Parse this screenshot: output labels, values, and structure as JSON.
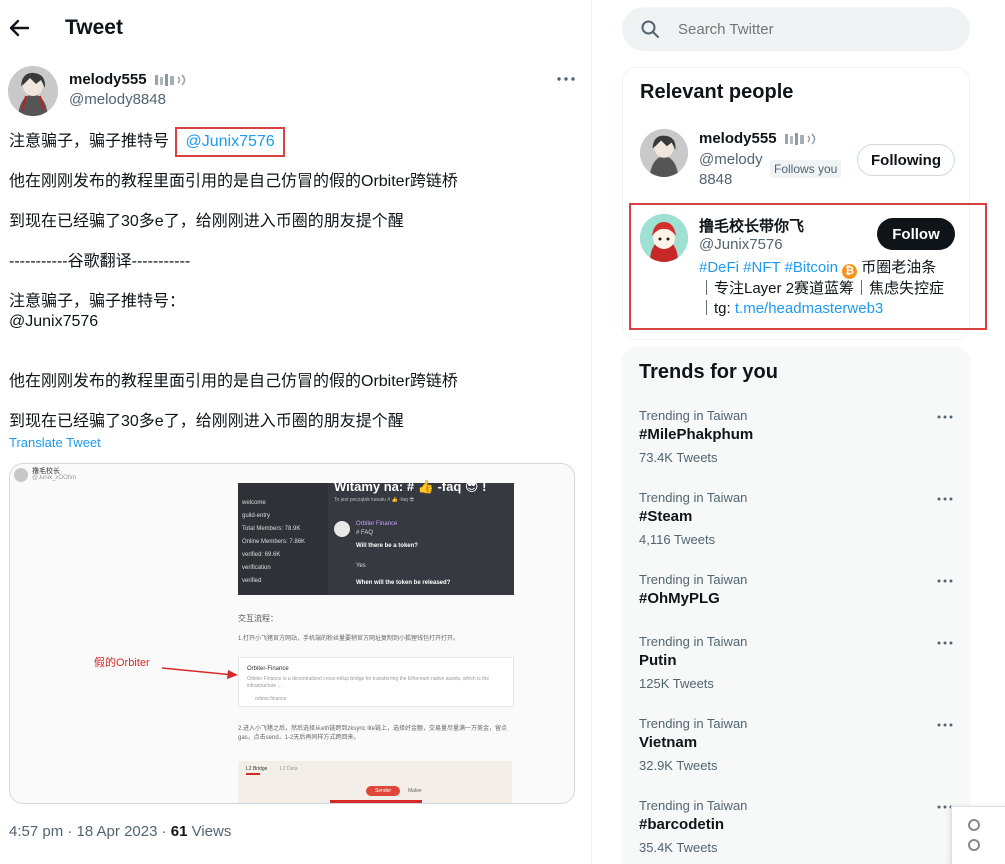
{
  "header": {
    "title": "Tweet",
    "back_icon": "arrow-left-icon"
  },
  "tweet": {
    "author_name": "melody555",
    "author_badge_icon": "fan-emoji-icon",
    "author_handle": "@melody8848",
    "lines": [
      "注意骗子，骗子推特号",
      "他在刚刚发布的教程里面引用的是自己仿冒的假的Orbiter跨链桥",
      "到现在已经骗了30多e了，给刚刚进入币圈的朋友提个醒",
      "-----------谷歌翻译-----------",
      "注意骗子，骗子推特号：",
      "@Junix7576",
      "他在刚刚发布的教程里面引用的是自己仿冒的假的Orbiter跨链桥",
      "到现在已经骗了30多e了，给刚刚进入币圈的朋友提个醒"
    ],
    "mention": "@Junix7576",
    "translate_label": "Translate Tweet",
    "time": "4:57 pm · 18 Apr 2023 · ",
    "views_count": "61",
    "views_label": " Views",
    "media": {
      "embedded_username": "撸毛校长",
      "embedded_handle": "@Junix_xOOhm",
      "discord_heading": "Witamy na: # 👍 -faq 😎 !",
      "discord_sub": "To jest początek kanału # 👍 -faq 😎",
      "channels": [
        "welcome",
        "guild-entry",
        "Total Members: 78.9K",
        "Online Members: 7.86K",
        "verified: 69.6K",
        "verification",
        "verified"
      ],
      "msg_author": "Orbiter Finance",
      "msg_tag": "# FAQ",
      "q1": "Will there be a token?",
      "a1": "Yes",
      "q2": "When will the token be released?",
      "section_label": "交互流程：",
      "step1": "1.打开小飞猪官方网站，手机端的粉丝量要稍官方网址复制到小狐狸钱包打开打开。",
      "fake_label": "假的Orbiter",
      "link_card_title": "Orbiter-Finance",
      "link_card_desc": "Orbiter Finance is a decentralized cross-rollup bridge for transferring the Ethereum native assets, which is the infrastructure ...",
      "link_card_url": "orbiter.finance",
      "step2": "2.进入小飞猪之后，然后选择从eth链跨到zksync lite链上，选择好金额，交易量尽量满一万美金，留点gas，点击send，1-2天后再同样方式跨回来。",
      "bridge_tabs": [
        "L2 Bridge",
        "L2 Data"
      ],
      "sender_label": "Sender",
      "maker_label": "Maker"
    }
  },
  "search": {
    "placeholder": "Search Twitter"
  },
  "relevant_people": {
    "heading": "Relevant people",
    "people": [
      {
        "name": "melody555",
        "handle_line1": "@melody",
        "handle_line2": "8848",
        "follows_you": "Follows you",
        "button": "Following"
      },
      {
        "name": "撸毛校长带你飞",
        "handle": "@Junix7576",
        "button": "Follow",
        "bio_tags": "#DeFi #NFT #Bitcoin",
        "bio_after_tags": " 币圈老油条",
        "bio_line2": "｜专注Layer 2赛道蓝筹｜焦虑失控症",
        "bio_line3_prefix": "｜tg: ",
        "bio_link": "t.me/headmasterweb3"
      }
    ]
  },
  "trends": {
    "heading": "Trends for you",
    "items": [
      {
        "context": "Trending in Taiwan",
        "name": "#MilePhakphum",
        "count": "73.4K Tweets"
      },
      {
        "context": "Trending in Taiwan",
        "name": "#Steam",
        "count": "4,116 Tweets"
      },
      {
        "context": "Trending in Taiwan",
        "name": "#OhMyPLG",
        "count": ""
      },
      {
        "context": "Trending in Taiwan",
        "name": "Putin",
        "count": "125K Tweets"
      },
      {
        "context": "Trending in Taiwan",
        "name": "Vietnam",
        "count": "32.9K Tweets"
      },
      {
        "context": "Trending in Taiwan",
        "name": "#barcodetin",
        "count": "35.4K Tweets"
      }
    ]
  },
  "colors": {
    "accent": "#1d9bf0",
    "text": "#0f1419",
    "secondary": "#536471",
    "highlight_box": "#d94141"
  }
}
